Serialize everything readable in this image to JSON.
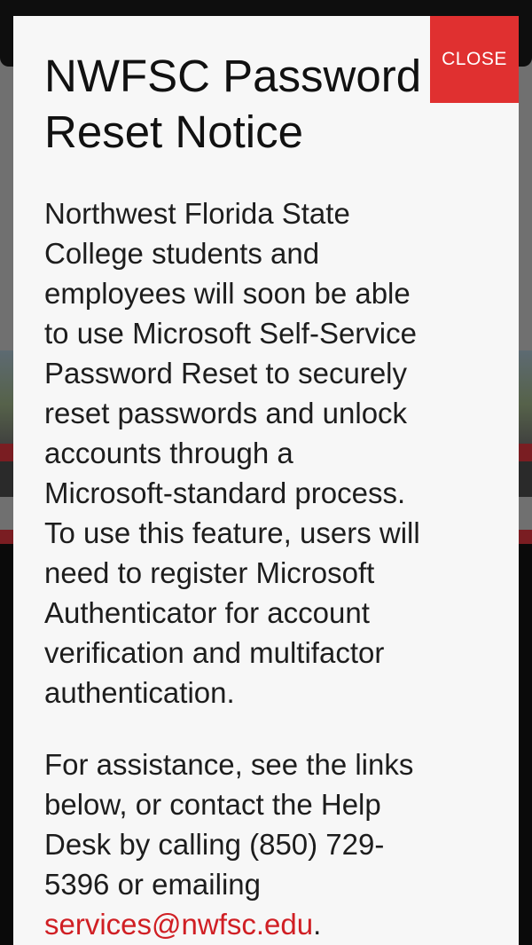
{
  "modal": {
    "title_lines": [
      "NWFSC Password",
      "Reset Notice"
    ],
    "close_label": "CLOSE",
    "paragraph1_lines": [
      "Northwest Florida State",
      "College students and",
      "employees will soon be able",
      "to use Microsoft Self-Service",
      "Password Reset to securely",
      "reset passwords and unlock",
      "accounts through a",
      "Microsoft-standard process.",
      "To use this feature, users will",
      "need to register Microsoft",
      "Authenticator for account",
      "verification and multifactor",
      "authentication."
    ],
    "paragraph2_lines": [
      "For assistance, see the links",
      "below, or contact the Help",
      "Desk by calling (850) 729-",
      "5396 or emailing"
    ],
    "email_link": "services@nwfsc.edu",
    "email_suffix": "."
  },
  "colors": {
    "close_button_bg": "#e03030",
    "link_color": "#d01f24",
    "modal_bg": "#f7f7f7"
  }
}
